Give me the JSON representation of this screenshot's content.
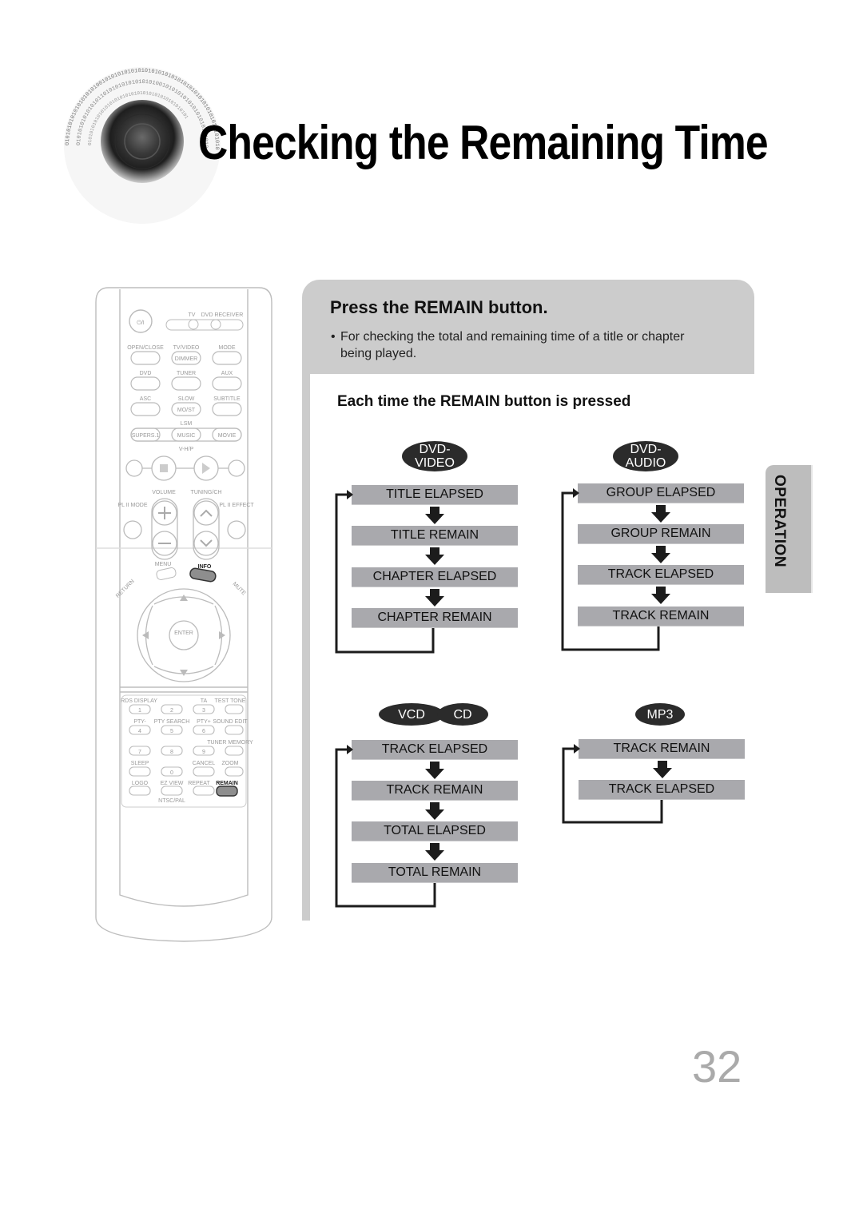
{
  "header": {
    "title": "Checking the Remaining Time",
    "decoration_icon": "speaker-icon"
  },
  "remote": {
    "icon": "remote-control-icon",
    "highlighted_buttons": [
      "INFO",
      "REMAIN"
    ],
    "labels": {
      "power": "⏻/I",
      "tv": "TV",
      "dvd_receiver": "DVD RECEIVER",
      "open_close": "OPEN/CLOSE",
      "tv_video": "TV/VIDEO",
      "dimmer": "DIMMER",
      "mode": "MODE",
      "dvd": "DVD",
      "tuner": "TUNER",
      "aux": "AUX",
      "asc": "ASC",
      "slow": "SLOW",
      "mo_st": "MO/ST",
      "subtitle": "SUBTITLE",
      "lsm": "LSM",
      "supers1": "SUPERS.1",
      "music": "MUSIC",
      "movie": "MOVIE",
      "vhp": "V-H/P",
      "volume": "VOLUME",
      "tuning_ch": "TUNING/CH",
      "pl2_mode": "PL II MODE",
      "pl2_effect": "PL II EFFECT",
      "menu": "MENU",
      "info": "INFO",
      "return": "RETURN",
      "mute": "MUTE",
      "enter": "ENTER",
      "rds_display": "RDS DISPLAY",
      "ta": "TA",
      "test_tone": "TEST TONE",
      "pty_minus": "PTY-",
      "pty_search": "PTY SEARCH",
      "pty_plus": "PTY+",
      "sound_edit": "SOUND EDIT",
      "tuner_memory": "TUNER MEMORY",
      "sleep": "SLEEP",
      "cancel": "CANCEL",
      "zoom": "ZOOM",
      "logo": "LOGO",
      "ez_view": "EZ VIEW",
      "repeat": "REPEAT",
      "remain": "REMAIN",
      "ntsc_pal": "NTSC/PAL",
      "digits": [
        "1",
        "2",
        "3",
        "4",
        "5",
        "6",
        "7",
        "8",
        "9",
        "0"
      ]
    }
  },
  "instruction": {
    "step_title": "Press the REMAIN button.",
    "bullet": "•",
    "note_line1": "For checking the total and remaining time of a title or chapter",
    "note_line2": "being played.",
    "subheading": "Each time the REMAIN button is pressed"
  },
  "flows": {
    "dvd_video": {
      "badge_line1": "DVD-",
      "badge_line2": "VIDEO",
      "steps": [
        "TITLE ELAPSED",
        "TITLE REMAIN",
        "CHAPTER ELAPSED",
        "CHAPTER REMAIN"
      ]
    },
    "dvd_audio": {
      "badge_line1": "DVD-",
      "badge_line2": "AUDIO",
      "steps": [
        "GROUP ELAPSED",
        "GROUP REMAIN",
        "TRACK ELAPSED",
        "TRACK REMAIN"
      ]
    },
    "vcd_cd": {
      "badges": [
        "VCD",
        "CD"
      ],
      "steps": [
        "TRACK ELAPSED",
        "TRACK REMAIN",
        "TOTAL ELAPSED",
        "TOTAL REMAIN"
      ]
    },
    "mp3": {
      "badges": [
        "MP3"
      ],
      "steps": [
        "TRACK REMAIN",
        "TRACK ELAPSED"
      ]
    }
  },
  "side_tab": {
    "label": "OPERATION"
  },
  "page_number": "32",
  "colors": {
    "panel_gray": "#cccccc",
    "box_gray": "#a9a9ad",
    "badge_dark": "#2b2b2b",
    "tab_gray": "#bdbdbd",
    "page_number": "#aaaaaa"
  }
}
